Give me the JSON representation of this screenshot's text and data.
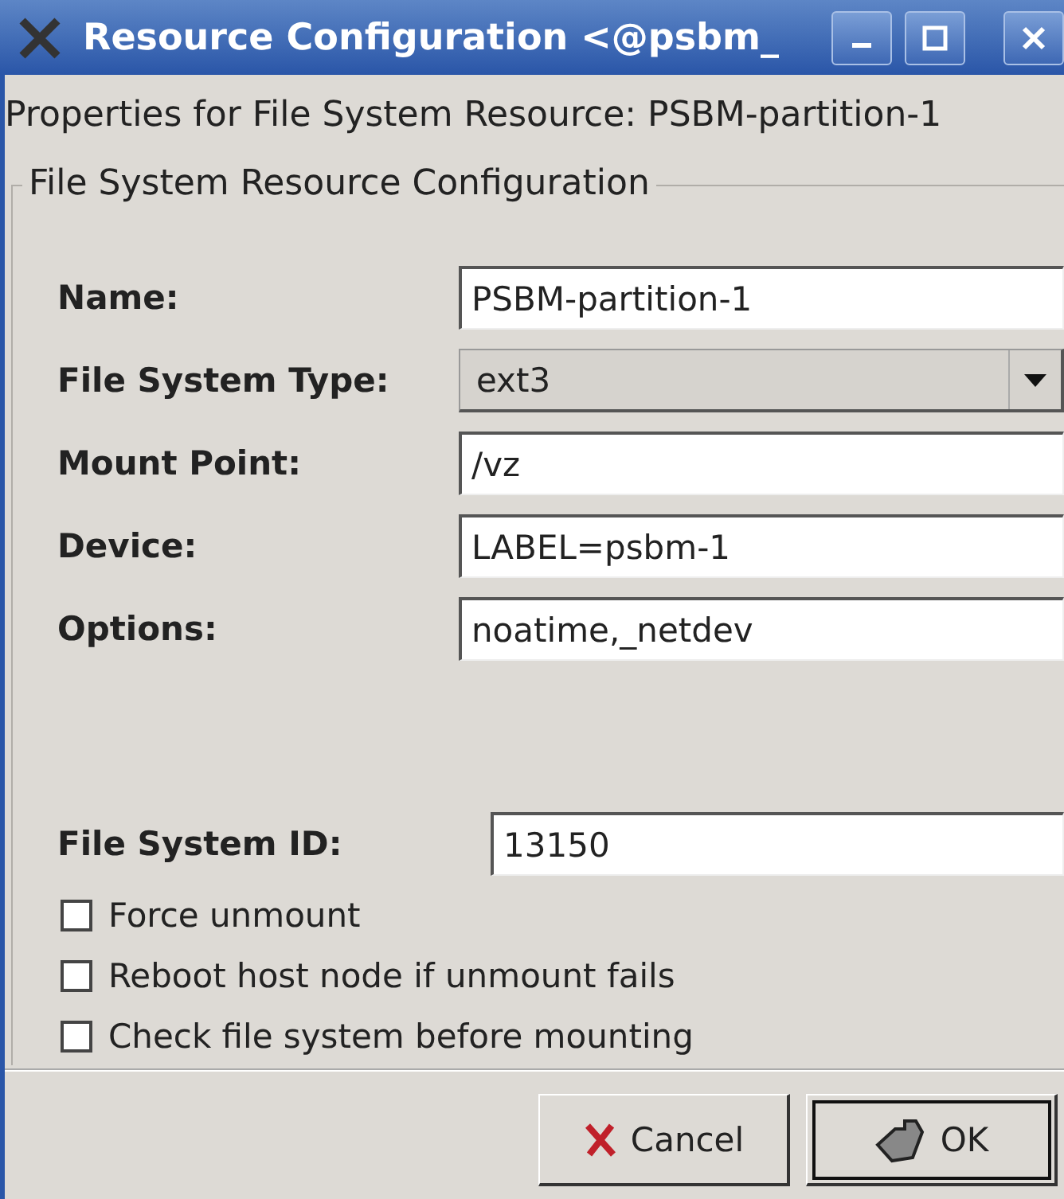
{
  "window": {
    "title": "Resource Configuration <@psbm_"
  },
  "heading": "Properties for File System Resource: PSBM-partition-1",
  "group": {
    "title": "File System Resource Configuration"
  },
  "fields": [
    {
      "kind": "text",
      "label": "Name:",
      "value": "PSBM-partition-1"
    },
    {
      "kind": "combo",
      "label": "File System Type:",
      "value": "ext3"
    },
    {
      "kind": "text",
      "label": "Mount Point:",
      "value": "/vz"
    },
    {
      "kind": "text",
      "label": "Device:",
      "value": "LABEL=psbm-1"
    },
    {
      "kind": "text",
      "label": "Options:",
      "value": "noatime,_netdev"
    }
  ],
  "fs_id": {
    "label": "File System ID:",
    "value": "13150"
  },
  "checkboxes": [
    {
      "label": "Force unmount",
      "checked": false
    },
    {
      "label": "Reboot host node if unmount fails",
      "checked": false
    },
    {
      "label": "Check file system before mounting",
      "checked": false
    }
  ],
  "buttons": [
    {
      "kind": "cancel",
      "label": "Cancel",
      "default": false
    },
    {
      "kind": "ok",
      "label": "OK",
      "default": true
    }
  ]
}
